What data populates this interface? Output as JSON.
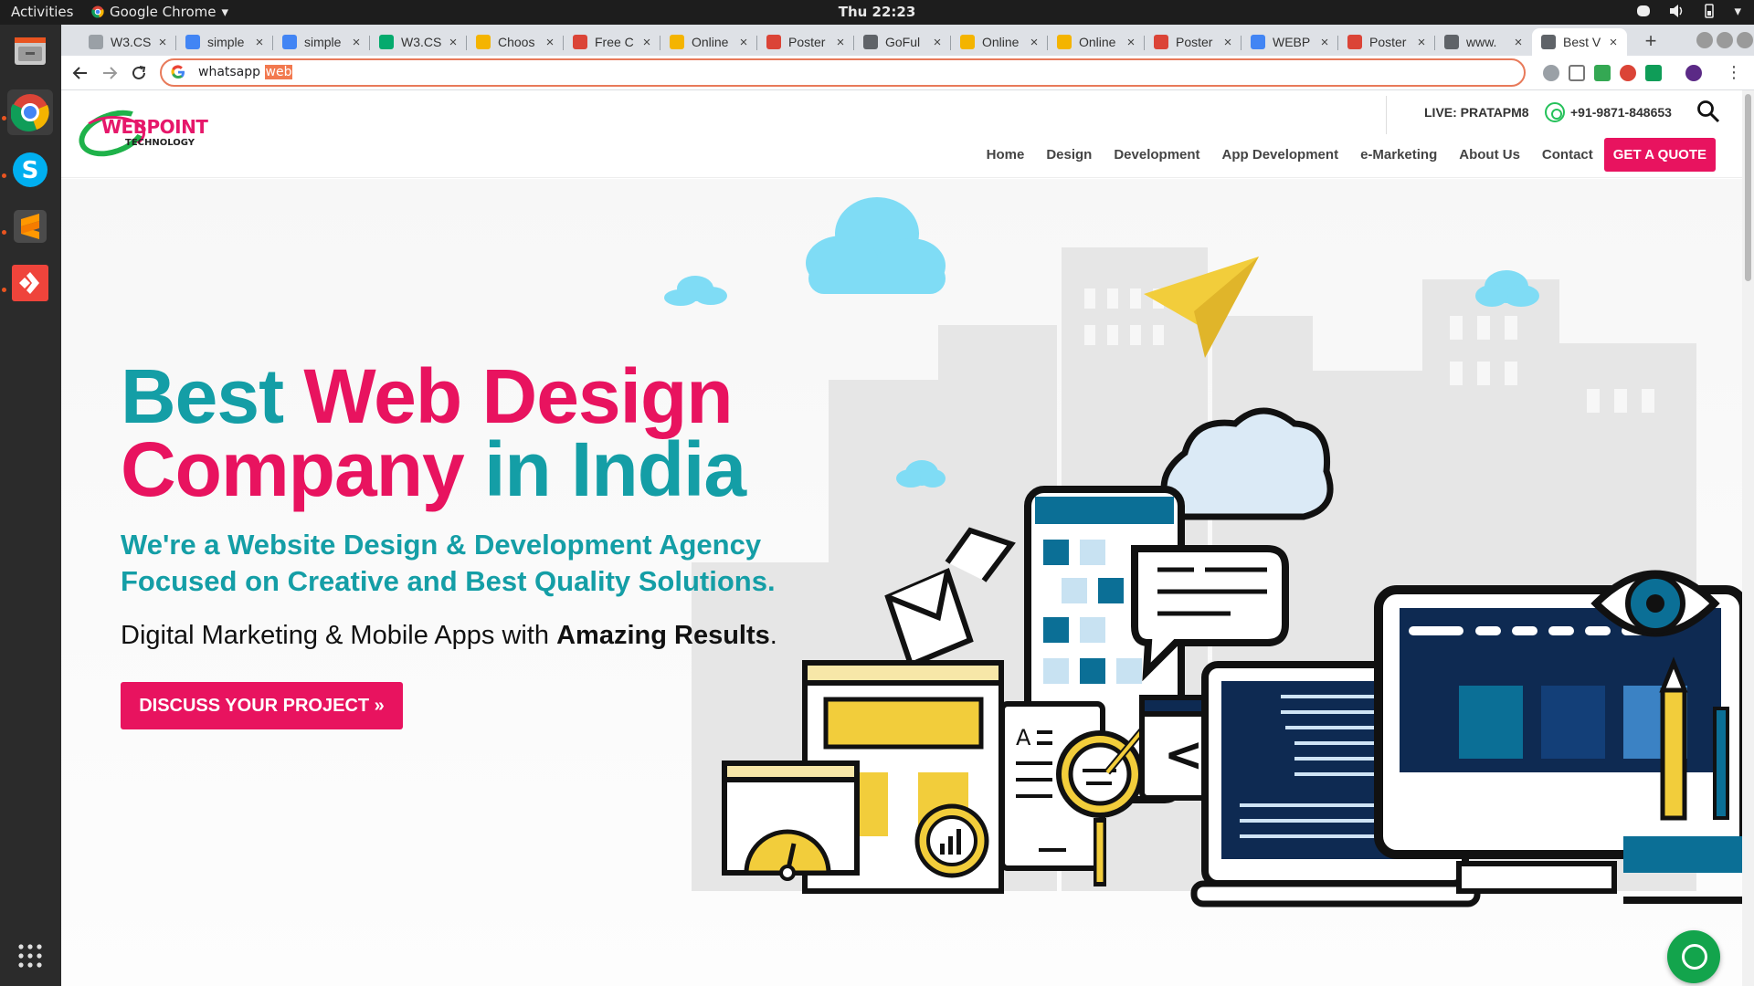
{
  "os": {
    "activities": "Activities",
    "app_name": "Google Chrome",
    "clock": "Thu 22:23"
  },
  "browser": {
    "tabs": [
      {
        "label": "W3.CS",
        "favicon_color": "#9aa0a6"
      },
      {
        "label": "simple",
        "favicon_color": "#4285f4"
      },
      {
        "label": "simple",
        "favicon_color": "#4285f4"
      },
      {
        "label": "W3.CS",
        "favicon_color": "#04aa6d"
      },
      {
        "label": "Choos",
        "favicon_color": "#f4b400"
      },
      {
        "label": "Free C",
        "favicon_color": "#db4437"
      },
      {
        "label": "Online",
        "favicon_color": "#f4b400"
      },
      {
        "label": "Poster",
        "favicon_color": "#db4437"
      },
      {
        "label": "GoFul",
        "favicon_color": "#5f6368"
      },
      {
        "label": "Online",
        "favicon_color": "#f4b400"
      },
      {
        "label": "Online",
        "favicon_color": "#f4b400"
      },
      {
        "label": "Poster",
        "favicon_color": "#db4437"
      },
      {
        "label": "WEBP",
        "favicon_color": "#4285f4"
      },
      {
        "label": "Poster",
        "favicon_color": "#db4437"
      },
      {
        "label": "www.",
        "favicon_color": "#5f6368"
      },
      {
        "label": "Best V",
        "favicon_color": "#5f6368"
      }
    ],
    "omnibox": {
      "typed": "whatsapp ",
      "autocomplete": "web"
    }
  },
  "site": {
    "logo": {
      "name": "WEBPOINT",
      "sub": "TECHNOLOGY"
    },
    "live": "LIVE: PRATAPM8",
    "phone": "+91-9871-848653",
    "nav": [
      "Home",
      "Design",
      "Development",
      "App Development",
      "e-Marketing",
      "About Us",
      "Contact"
    ],
    "quote": "GET A QUOTE",
    "hero": {
      "h1_part1": "Best ",
      "h1_part2": "Web Design",
      "h1_part3": "Company ",
      "h1_part4": "in India",
      "sub1": "We're a Website Design & Development Agency",
      "sub2": "Focused on Creative and Best Quality Solutions.",
      "tagline_a": "Digital Marketing & Mobile Apps with ",
      "tagline_b": "Amazing Results",
      "tagline_c": ".",
      "cta": "DISCUSS YOUR PROJECT »",
      "code_glyph": "</>"
    }
  },
  "colors": {
    "brand_pink": "#e8135f",
    "brand_teal": "#149ea6",
    "navy": "#0e2a52",
    "yellow": "#f2cd3b"
  }
}
